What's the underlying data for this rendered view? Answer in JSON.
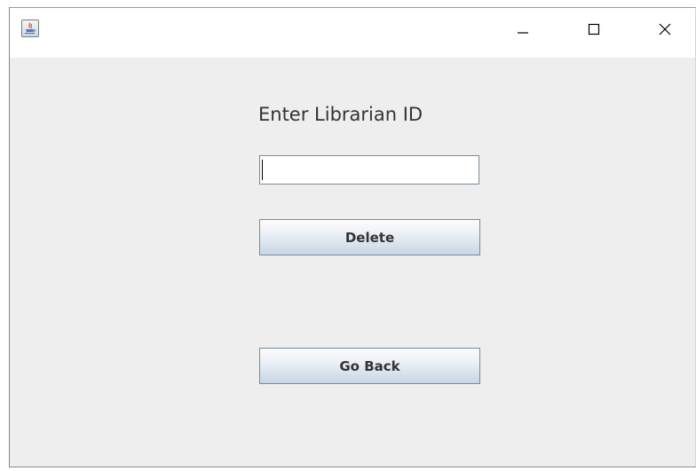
{
  "window": {
    "title": "",
    "controls": {
      "minimize_icon": "minimize-icon",
      "maximize_icon": "maximize-icon",
      "close_icon": "close-icon"
    }
  },
  "form": {
    "prompt_label": "Enter Librarian ID",
    "librarian_id_value": "",
    "librarian_id_placeholder": "",
    "delete_label": "Delete",
    "go_back_label": "Go Back"
  },
  "colors": {
    "content_bg": "#eeeeee",
    "titlebar_bg": "#ffffff",
    "button_border": "#7a8a99",
    "label_text": "#333333"
  }
}
